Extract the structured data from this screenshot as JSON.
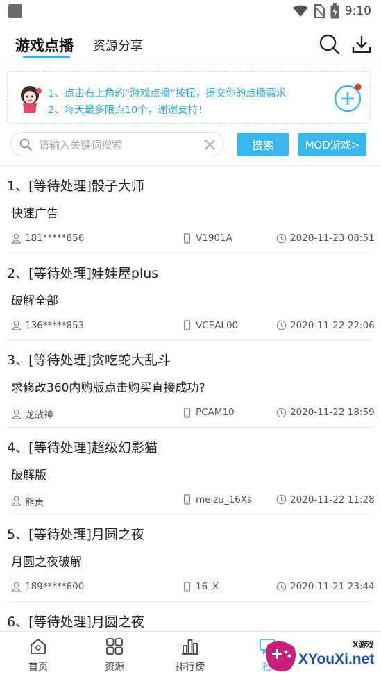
{
  "status_bar": {
    "time": "9:10"
  },
  "header": {
    "tabs": [
      {
        "label": "游戏点播",
        "active": true
      },
      {
        "label": "资源分享",
        "active": false
      }
    ]
  },
  "notice": {
    "line1": "1、点击右上角的“游戏点播”按钮，提交你的点播需求",
    "line2": "2、每天最多限点10个，谢谢支持！"
  },
  "search": {
    "placeholder": "请输入关键词搜索",
    "value": "",
    "search_label": "搜索",
    "mod_label": "MOD游戏>"
  },
  "requests": [
    {
      "title": "1、[等待处理]骰子大师",
      "desc": "快速广告",
      "user": "181*****856",
      "device": "V1901A",
      "time": "2020-11-23 08:51"
    },
    {
      "title": "2、[等待处理]娃娃屋plus",
      "desc": "破解全部",
      "user": "136*****853",
      "device": "VCEAL00",
      "time": "2020-11-22 22:06"
    },
    {
      "title": "3、[等待处理]贪吃蛇大乱斗",
      "desc": "求修改360内购版点击购买直接成功?",
      "user": "龙战神",
      "device": "PCAM10",
      "time": "2020-11-22 18:59"
    },
    {
      "title": "4、[等待处理]超级幻影猫",
      "desc": "破解版",
      "user": "熊贡",
      "device": "meizu_16Xs",
      "time": "2020-11-22 11:28"
    },
    {
      "title": "5、[等待处理]月圆之夜",
      "desc": "月圆之夜破解",
      "user": "189*****600",
      "device": "16_X",
      "time": "2020-11-21 23:44"
    },
    {
      "title": "6、[等待处理]月圆之夜",
      "desc": "",
      "user": "",
      "device": "",
      "time": ""
    }
  ],
  "bottom_nav": [
    {
      "label": "首页",
      "icon": "home-icon"
    },
    {
      "label": "资源",
      "icon": "grid-icon"
    },
    {
      "label": "排行榜",
      "icon": "ranking-icon"
    },
    {
      "label": "社",
      "icon": "community-icon"
    }
  ],
  "watermark": {
    "text": "XYouXi.net",
    "sub": "X游戏"
  },
  "colors": {
    "accent": "#3ab6ee",
    "notice_text": "#2aa8e2",
    "badge": "#e5322d"
  }
}
